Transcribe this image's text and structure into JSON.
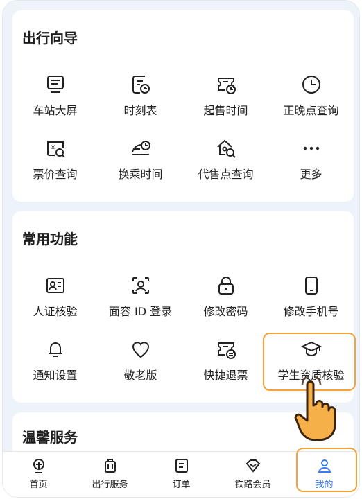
{
  "travel_guide": {
    "title": "出行向导",
    "items": [
      {
        "label": "车站大屏",
        "icon": "station-screen-icon"
      },
      {
        "label": "时刻表",
        "icon": "timetable-icon"
      },
      {
        "label": "起售时间",
        "icon": "sale-time-icon"
      },
      {
        "label": "正晚点查询",
        "icon": "clock-icon"
      },
      {
        "label": "票价查询",
        "icon": "fare-search-icon"
      },
      {
        "label": "换乘时间",
        "icon": "transfer-time-icon"
      },
      {
        "label": "代售点查询",
        "icon": "agency-search-icon"
      },
      {
        "label": "更多",
        "icon": "more-icon"
      }
    ]
  },
  "common_functions": {
    "title": "常用功能",
    "items": [
      {
        "label": "人证核验",
        "icon": "id-verify-icon"
      },
      {
        "label": "面容 ID 登录",
        "icon": "face-id-icon"
      },
      {
        "label": "修改密码",
        "icon": "lock-icon"
      },
      {
        "label": "修改手机号",
        "icon": "phone-icon"
      },
      {
        "label": "通知设置",
        "icon": "bell-icon"
      },
      {
        "label": "敬老版",
        "icon": "heart-icon"
      },
      {
        "label": "快捷退票",
        "icon": "refund-ticket-icon"
      },
      {
        "label": "学生资质核验",
        "icon": "graduation-cap-icon"
      }
    ]
  },
  "warm_service": {
    "title": "温馨服务"
  },
  "tabbar": {
    "tabs": [
      {
        "label": "首页",
        "icon": "home-rail-icon"
      },
      {
        "label": "出行服务",
        "icon": "luggage-icon"
      },
      {
        "label": "订单",
        "icon": "order-icon"
      },
      {
        "label": "铁路会员",
        "icon": "member-diamond-icon"
      },
      {
        "label": "我的",
        "icon": "user-icon"
      }
    ],
    "active": "我的"
  },
  "colors": {
    "accent": "#3d7cf0",
    "highlight": "#f5a23a",
    "background": "#eef3fa"
  }
}
